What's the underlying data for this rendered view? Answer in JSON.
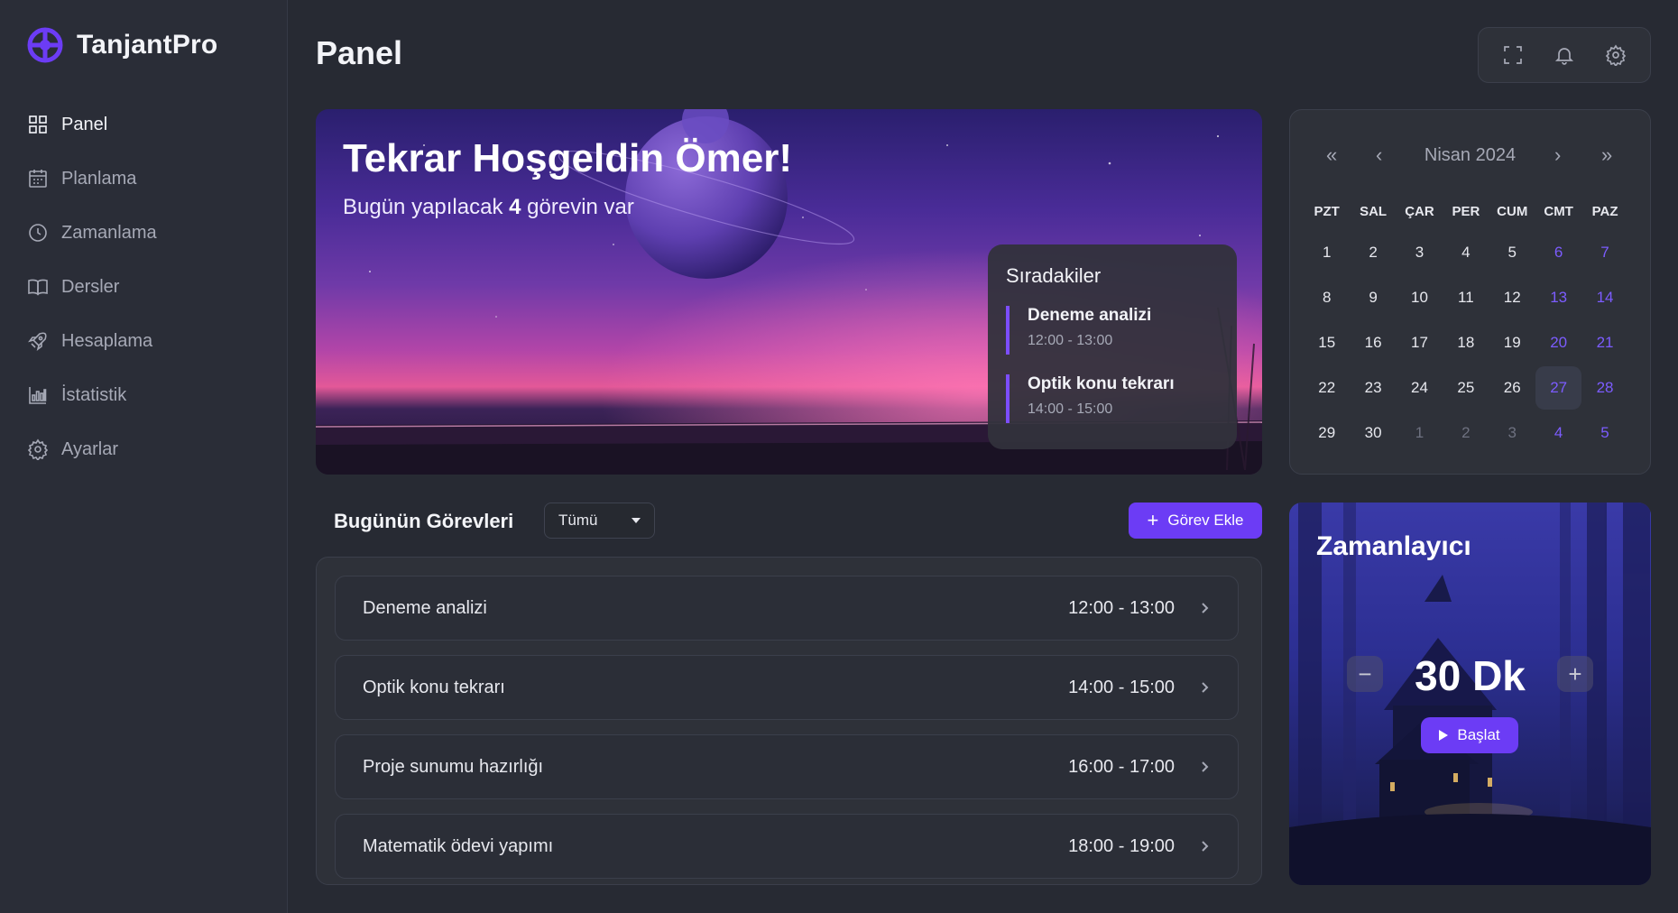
{
  "brand": {
    "name": "TanjantPro"
  },
  "sidebar": {
    "items": [
      {
        "label": "Panel",
        "icon": "grid-icon"
      },
      {
        "label": "Planlama",
        "icon": "calendar-icon"
      },
      {
        "label": "Zamanlama",
        "icon": "clock-icon"
      },
      {
        "label": "Dersler",
        "icon": "book-icon"
      },
      {
        "label": "Hesaplama",
        "icon": "rocket-icon"
      },
      {
        "label": "İstatistik",
        "icon": "bar-chart-icon"
      },
      {
        "label": "Ayarlar",
        "icon": "gear-icon"
      }
    ]
  },
  "header": {
    "title": "Panel",
    "toolbar": [
      "fullscreen-icon",
      "bell-icon",
      "gear-icon"
    ]
  },
  "hero": {
    "greeting": "Tekrar Hoşgeldin Ömer!",
    "subtitle_prefix": "Bugün yapılacak",
    "task_count": "4",
    "subtitle_suffix": "görevin var",
    "upcoming_title": "Sıradakiler",
    "upcoming": [
      {
        "name": "Deneme analizi",
        "time": "12:00 - 13:00"
      },
      {
        "name": "Optik konu tekrarı",
        "time": "14:00 - 15:00"
      }
    ]
  },
  "calendar": {
    "month": "Nisan 2024",
    "nav": {
      "prev_year": "«",
      "prev_month": "‹",
      "next_month": "›",
      "next_year": "»"
    },
    "weekdays": [
      "PZT",
      "SAL",
      "ÇAR",
      "PER",
      "CUM",
      "CMT",
      "PAZ"
    ],
    "weeks": [
      [
        "1",
        "2",
        "3",
        "4",
        "5",
        "6",
        "7"
      ],
      [
        "8",
        "9",
        "10",
        "11",
        "12",
        "13",
        "14"
      ],
      [
        "15",
        "16",
        "17",
        "18",
        "19",
        "20",
        "21"
      ],
      [
        "22",
        "23",
        "24",
        "25",
        "26",
        "27",
        "28"
      ],
      [
        "29",
        "30",
        "1",
        "2",
        "3",
        "4",
        "5"
      ]
    ],
    "today": "27"
  },
  "tasks": {
    "title": "Bugünün Görevleri",
    "filter_value": "Tümü",
    "add_label": "Görev Ekle",
    "items": [
      {
        "name": "Deneme analizi",
        "time": "12:00 - 13:00"
      },
      {
        "name": "Optik konu tekrarı",
        "time": "14:00 - 15:00"
      },
      {
        "name": "Proje sunumu hazırlığı",
        "time": "16:00 - 17:00"
      },
      {
        "name": "Matematik ödevi yapımı",
        "time": "18:00 - 19:00"
      }
    ]
  },
  "timer": {
    "title": "Zamanlayıcı",
    "value": "30 Dk",
    "decrease": "−",
    "increase": "+",
    "start_label": "Başlat"
  },
  "colors": {
    "accent": "#6c3cf5",
    "weekend": "#7c5cff",
    "background": "#272a33",
    "panel": "#2e3139"
  }
}
